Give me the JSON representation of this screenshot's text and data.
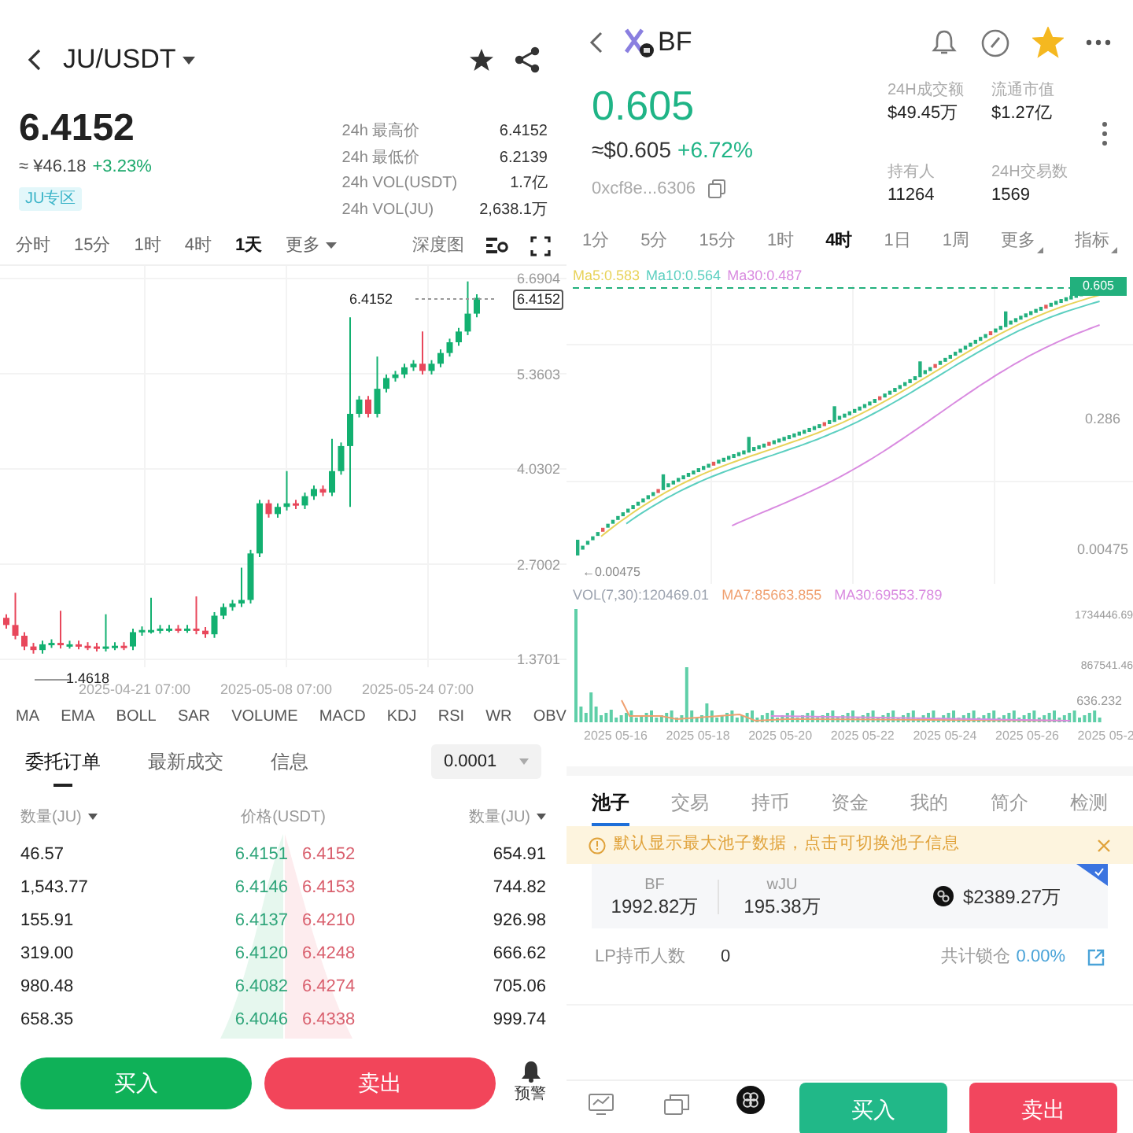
{
  "left": {
    "pair": "JU/USDT",
    "price": "6.4152",
    "fiat": "≈ ¥46.18",
    "change": "+3.23%",
    "zone_badge": "JU专区",
    "stats": [
      {
        "label": "24h 最高价",
        "value": "6.4152"
      },
      {
        "label": "24h 最低价",
        "value": "6.2139"
      },
      {
        "label": "24h VOL(USDT)",
        "value": "1.7亿"
      },
      {
        "label": "24h VOL(JU)",
        "value": "2,638.1万"
      }
    ],
    "timeframes": [
      {
        "label": "分时",
        "selected": false
      },
      {
        "label": "15分",
        "selected": false
      },
      {
        "label": "1时",
        "selected": false
      },
      {
        "label": "4时",
        "selected": false
      },
      {
        "label": "1天",
        "selected": true
      }
    ],
    "more": "更多",
    "depth_chart": "深度图",
    "chart": {
      "y_labels": [
        "6.6904",
        "5.3603",
        "4.0302",
        "2.7002",
        "1.3701"
      ],
      "last_price": "6.4152",
      "price_tag": "6.4152",
      "low_label": "1.4618",
      "x_labels": [
        "2025-04-21 07:00",
        "2025-05-08 07:00",
        "2025-05-24 07:00"
      ]
    },
    "indicators": [
      "MA",
      "EMA",
      "BOLL",
      "SAR",
      "VOLUME",
      "MACD",
      "KDJ",
      "RSI",
      "WR",
      "OBV"
    ],
    "book_tabs": [
      {
        "label": "委托订单",
        "selected": true
      },
      {
        "label": "最新成交",
        "selected": false
      },
      {
        "label": "信息",
        "selected": false
      }
    ],
    "precision": "0.0001",
    "book_headers": {
      "bid_qty": "数量(JU)",
      "price": "价格(USDT)",
      "ask_qty": "数量(JU)"
    },
    "book_rows": [
      {
        "bid_qty": "46.57",
        "bid": "6.4151",
        "ask": "6.4152",
        "ask_qty": "654.91"
      },
      {
        "bid_qty": "1,543.77",
        "bid": "6.4146",
        "ask": "6.4153",
        "ask_qty": "744.82"
      },
      {
        "bid_qty": "155.91",
        "bid": "6.4137",
        "ask": "6.4210",
        "ask_qty": "926.98"
      },
      {
        "bid_qty": "319.00",
        "bid": "6.4120",
        "ask": "6.4248",
        "ask_qty": "666.62"
      },
      {
        "bid_qty": "980.48",
        "bid": "6.4082",
        "ask": "6.4274",
        "ask_qty": "705.06"
      },
      {
        "bid_qty": "658.35",
        "bid": "6.4046",
        "ask": "6.4338",
        "ask_qty": "999.74"
      }
    ],
    "buy": "买入",
    "sell": "卖出",
    "alert": "预警"
  },
  "right": {
    "token": "BF",
    "favorite": true,
    "price": "0.605",
    "usd": "≈$0.605",
    "change": "+6.72%",
    "address": "0xcf8e...6306",
    "stats": [
      {
        "label": "24H成交额",
        "value": "$49.45万"
      },
      {
        "label": "流通市值",
        "value": "$1.27亿"
      },
      {
        "label": "持有人",
        "value": "11264"
      },
      {
        "label": "24H交易数",
        "value": "1569"
      }
    ],
    "timeframes": [
      {
        "label": "1分",
        "selected": false
      },
      {
        "label": "5分",
        "selected": false
      },
      {
        "label": "15分",
        "selected": false
      },
      {
        "label": "1时",
        "selected": false
      },
      {
        "label": "4时",
        "selected": true
      },
      {
        "label": "1日",
        "selected": false
      },
      {
        "label": "1周",
        "selected": false
      }
    ],
    "more": "更多",
    "indicators": "指标",
    "ma_legend": [
      {
        "text": "Ma5:0.583",
        "color": "#e8d35a"
      },
      {
        "text": "Ma10:0.564",
        "color": "#5ccfc0"
      },
      {
        "text": "Ma30:0.487",
        "color": "#d98be0"
      }
    ],
    "chart": {
      "price_tag": "0.605",
      "y_labels": [
        "0.286",
        "0.00475"
      ],
      "low_label": "←0.00475"
    },
    "vol_legend": [
      {
        "text": "VOL(7,30):120469.01",
        "color": "#9ca3af"
      },
      {
        "text": "MA7:85663.855",
        "color": "#f0a070"
      },
      {
        "text": "MA30:69553.789",
        "color": "#d98be0"
      }
    ],
    "vol_labels": [
      "1734446.69",
      "867541.46",
      "636.232"
    ],
    "x_labels": [
      "2025 05-16",
      "2025 05-18",
      "2025 05-20",
      "2025 05-22",
      "2025 05-24",
      "2025 05-26",
      "2025 05-2"
    ],
    "tabs": [
      {
        "label": "池子",
        "selected": true
      },
      {
        "label": "交易",
        "selected": false
      },
      {
        "label": "持币",
        "selected": false
      },
      {
        "label": "资金",
        "selected": false
      },
      {
        "label": "我的",
        "selected": false
      },
      {
        "label": "简介",
        "selected": false
      },
      {
        "label": "检测",
        "selected": false
      }
    ],
    "notice": "默认显示最大池子数据，点击可切换池子信息",
    "pool": {
      "selected": true,
      "token_a": "BF",
      "amount_a": "1992.82万",
      "token_b": "wJU",
      "amount_b": "195.38万",
      "total": "$2389.27万"
    },
    "lp_label": "LP持币人数",
    "lp_value": "0",
    "locked_label": "共计锁仓",
    "locked_value": "0.00%",
    "buy": "买入",
    "sell": "卖出"
  }
}
